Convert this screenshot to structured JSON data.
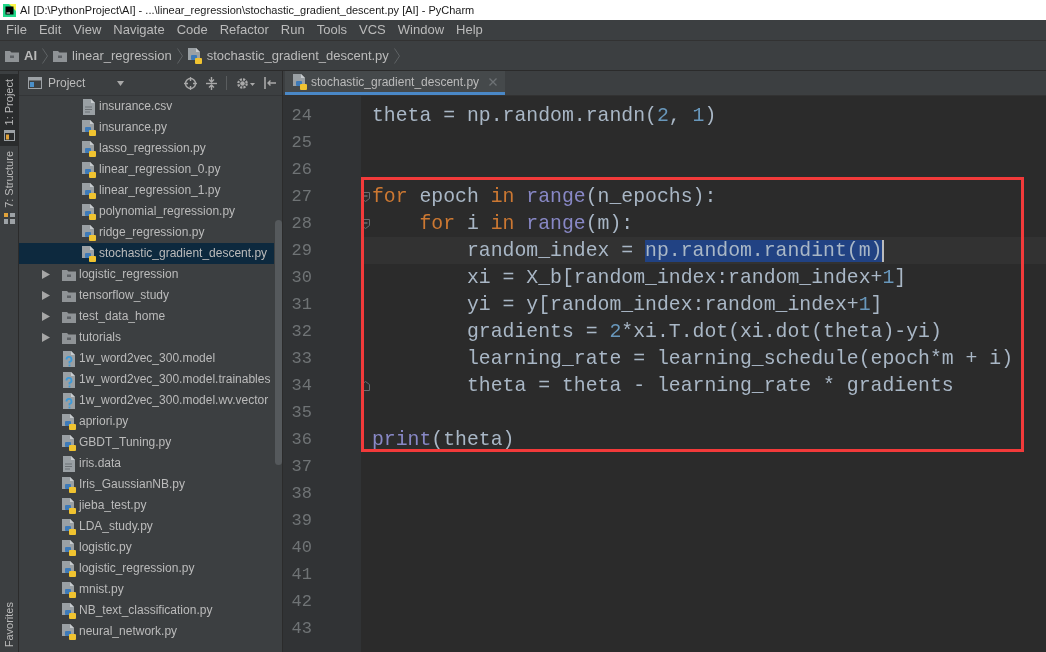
{
  "window": {
    "title": "AI [D:\\PythonProject\\AI] - ...\\linear_regression\\stochastic_gradient_descent.py [AI] - PyCharm"
  },
  "menu": [
    "File",
    "Edit",
    "View",
    "Navigate",
    "Code",
    "Refactor",
    "Run",
    "Tools",
    "VCS",
    "Window",
    "Help"
  ],
  "breadcrumbs": [
    {
      "label": "AI",
      "kind": "root"
    },
    {
      "label": "linear_regression",
      "kind": "folder"
    },
    {
      "label": "stochastic_gradient_descent.py",
      "kind": "python"
    }
  ],
  "tool_strip": {
    "top": [
      {
        "label": "1: Project",
        "kind": "project",
        "selected": true
      },
      {
        "label": "7: Structure",
        "kind": "structure",
        "selected": false
      }
    ],
    "bottom": [
      {
        "label": "Favorites",
        "selected": false
      }
    ]
  },
  "project_panel": {
    "title": "Project",
    "tree": [
      {
        "children": [
          {
            "label": "insurance.csv",
            "kind": "text",
            "selected": false
          },
          {
            "label": "insurance.py",
            "kind": "python",
            "selected": false
          },
          {
            "label": "lasso_regression.py",
            "kind": "python",
            "selected": false
          },
          {
            "label": "linear_regression_0.py",
            "kind": "python",
            "selected": false
          },
          {
            "label": "linear_regression_1.py",
            "kind": "python",
            "selected": false
          },
          {
            "label": "polynomial_regression.py",
            "kind": "python",
            "selected": false
          },
          {
            "label": "ridge_regression.py",
            "kind": "python",
            "selected": false
          },
          {
            "label": "stochastic_gradient_descent.py",
            "kind": "python",
            "selected": true
          }
        ]
      },
      {
        "label": "logistic_regression",
        "kind": "folder",
        "expanded": false,
        "selected": false
      },
      {
        "label": "tensorflow_study",
        "kind": "folder",
        "expanded": false,
        "selected": false
      },
      {
        "label": "test_data_home",
        "kind": "folder",
        "expanded": false,
        "selected": false
      },
      {
        "label": "tutorials",
        "kind": "folder",
        "expanded": false,
        "selected": false
      },
      {
        "label": "1w_word2vec_300.model",
        "kind": "unknown",
        "selected": false
      },
      {
        "label": "1w_word2vec_300.model.trainables",
        "kind": "unknown",
        "selected": false
      },
      {
        "label": "1w_word2vec_300.model.wv.vector",
        "kind": "unknown",
        "selected": false
      },
      {
        "label": "apriori.py",
        "kind": "python",
        "selected": false
      },
      {
        "label": "GBDT_Tuning.py",
        "kind": "python",
        "selected": false
      },
      {
        "label": "iris.data",
        "kind": "text",
        "selected": false
      },
      {
        "label": "Iris_GaussianNB.py",
        "kind": "python",
        "selected": false
      },
      {
        "label": "jieba_test.py",
        "kind": "python",
        "selected": false
      },
      {
        "label": "LDA_study.py",
        "kind": "python",
        "selected": false
      },
      {
        "label": "logistic.py",
        "kind": "python",
        "selected": false
      },
      {
        "label": "logistic_regression.py",
        "kind": "python",
        "selected": false
      },
      {
        "label": "mnist.py",
        "kind": "python",
        "selected": false
      },
      {
        "label": "NB_text_classification.py",
        "kind": "python",
        "selected": false
      },
      {
        "label": "neural_network.py",
        "kind": "python",
        "selected": false
      }
    ]
  },
  "editor": {
    "tabs": [
      {
        "label": "stochastic_gradient_descent.py",
        "kind": "python",
        "selected": true
      }
    ],
    "lines": [
      {
        "number": "24",
        "kind": "plain",
        "current": false,
        "tokens": [
          {
            "text": "theta = np.random.randn(",
            "kind": "plain"
          },
          {
            "text": "2",
            "kind": "number"
          },
          {
            "text": ", ",
            "kind": "plain"
          },
          {
            "text": "1",
            "kind": "number"
          },
          {
            "text": ")",
            "kind": "plain"
          }
        ]
      },
      {
        "number": "25",
        "kind": "plain",
        "current": false
      },
      {
        "number": "26",
        "kind": "plain",
        "current": false
      },
      {
        "number": "27",
        "kind": "fold_start",
        "current": false,
        "tokens": [
          {
            "text": "for",
            "kind": "keyword"
          },
          {
            "text": " epoch ",
            "kind": "plain"
          },
          {
            "text": "in",
            "kind": "keyword"
          },
          {
            "text": " range",
            "kind": "builtin"
          },
          {
            "text": "(n_epochs):",
            "kind": "plain"
          }
        ]
      },
      {
        "number": "28",
        "kind": "fold_start",
        "current": false,
        "tokens": [
          {
            "text": "    for",
            "kind": "keyword"
          },
          {
            "text": " i ",
            "kind": "plain"
          },
          {
            "text": "in",
            "kind": "keyword"
          },
          {
            "text": " range",
            "kind": "builtin"
          },
          {
            "text": "(m):",
            "kind": "plain"
          }
        ]
      },
      {
        "number": "29",
        "kind": "plain",
        "current": true,
        "tokens": [
          {
            "text": "        random_index = ",
            "kind": "plain"
          },
          {
            "text": "np.random.randint(m)",
            "kind": "selection"
          }
        ]
      },
      {
        "number": "30",
        "kind": "plain",
        "current": false,
        "tokens": [
          {
            "text": "        xi = X_b[random_index:random_index+",
            "kind": "plain"
          },
          {
            "text": "1",
            "kind": "number"
          },
          {
            "text": "]",
            "kind": "plain"
          }
        ]
      },
      {
        "number": "31",
        "kind": "plain",
        "current": false,
        "tokens": [
          {
            "text": "        yi = y[random_index:random_index+",
            "kind": "plain"
          },
          {
            "text": "1",
            "kind": "number"
          },
          {
            "text": "]",
            "kind": "plain"
          }
        ]
      },
      {
        "number": "32",
        "kind": "plain",
        "current": false,
        "tokens": [
          {
            "text": "        gradients = ",
            "kind": "plain"
          },
          {
            "text": "2",
            "kind": "number"
          },
          {
            "text": "*xi.T.dot(xi.dot(theta)-yi)",
            "kind": "plain"
          }
        ]
      },
      {
        "number": "33",
        "kind": "plain",
        "current": false,
        "tokens": [
          {
            "text": "        learning_rate = learning_schedule(epoch*m + i)",
            "kind": "plain"
          }
        ]
      },
      {
        "number": "34",
        "kind": "fold_end",
        "current": false,
        "tokens": [
          {
            "text": "        theta = theta - learning_rate * gradients",
            "kind": "plain"
          }
        ]
      },
      {
        "number": "35",
        "kind": "plain",
        "current": false
      },
      {
        "number": "36",
        "kind": "plain",
        "current": false,
        "tokens": [
          {
            "text": "print",
            "kind": "builtin"
          },
          {
            "text": "(theta)",
            "kind": "plain"
          }
        ]
      },
      {
        "number": "37",
        "kind": "plain",
        "current": false
      },
      {
        "number": "38",
        "kind": "plain",
        "current": false
      },
      {
        "number": "39",
        "kind": "plain",
        "current": false
      },
      {
        "number": "40",
        "kind": "plain",
        "current": false
      },
      {
        "number": "41",
        "kind": "plain",
        "current": false
      },
      {
        "number": "42",
        "kind": "plain",
        "current": false
      },
      {
        "number": "43",
        "kind": "plain",
        "current": false
      }
    ]
  }
}
